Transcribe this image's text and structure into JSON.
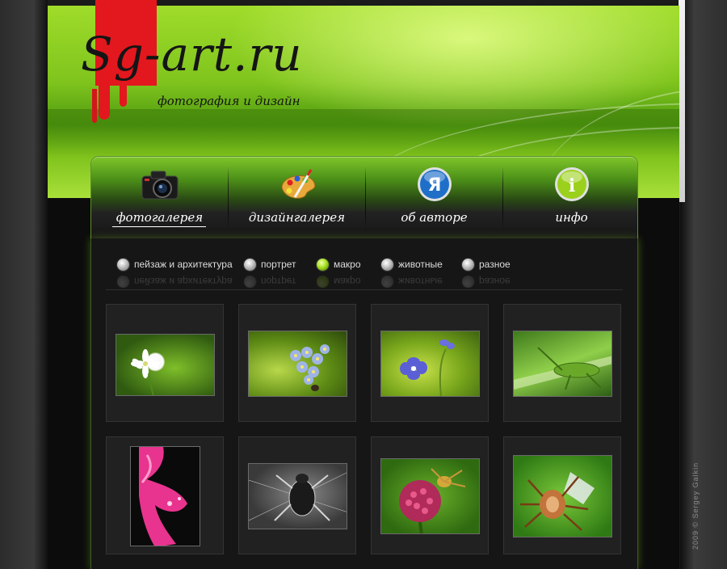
{
  "header": {
    "logo_text": "Sg-art.ru",
    "tagline": "фотография и дизайн"
  },
  "nav": {
    "items": [
      {
        "label": "фотогалерея",
        "icon": "camera-icon",
        "active": true
      },
      {
        "label": "дизайнгалерея",
        "icon": "palette-icon",
        "active": false
      },
      {
        "label": "об авторе",
        "icon": "ya-icon",
        "active": false
      },
      {
        "label": "инфо",
        "icon": "info-icon",
        "active": false
      }
    ]
  },
  "filters": {
    "items": [
      {
        "label": "пейзаж и архитектура",
        "active": false
      },
      {
        "label": "портрет",
        "active": false
      },
      {
        "label": "макро",
        "active": true
      },
      {
        "label": "животные",
        "active": false
      },
      {
        "label": "разное",
        "active": false
      }
    ]
  },
  "gallery": {
    "thumbnails": [
      {
        "subject": "white-flower"
      },
      {
        "subject": "forget-me-not-flowers"
      },
      {
        "subject": "purple-flower"
      },
      {
        "subject": "grasshopper"
      },
      {
        "subject": "pink-flower"
      },
      {
        "subject": "spider-monochrome"
      },
      {
        "subject": "spider-on-thistle"
      },
      {
        "subject": "orb-weaver-spider"
      }
    ]
  },
  "footer": {
    "copyright": "2009 © Sergey Galkin"
  },
  "colors": {
    "accent_green": "#8fd12a",
    "brand_red": "#e3171e",
    "background": "#0c0c0c"
  }
}
